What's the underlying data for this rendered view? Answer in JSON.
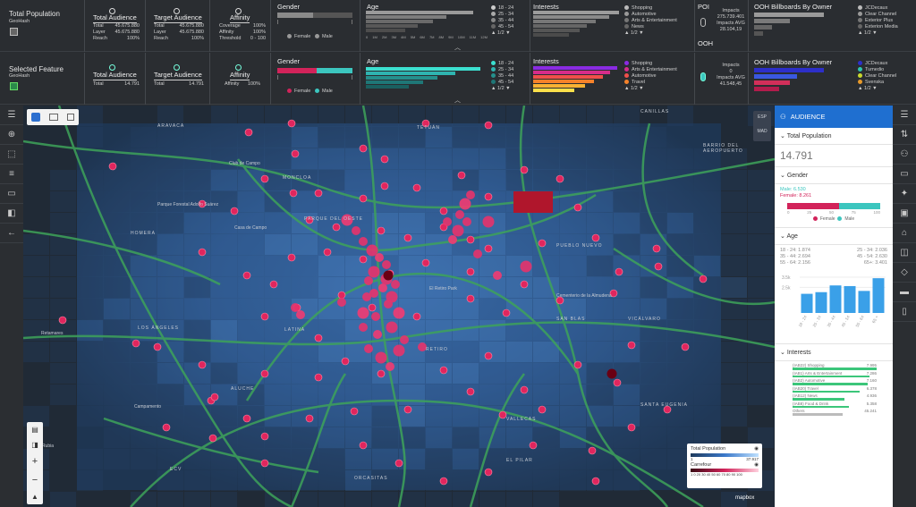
{
  "row1": {
    "title": "Total Population",
    "subtitle": "GeoHash",
    "total_audience": {
      "label": "Total Audience",
      "rows": [
        [
          "Total",
          "45.675.880"
        ],
        [
          "Layer",
          "45.675.880"
        ],
        [
          "Reach",
          "100%"
        ]
      ]
    },
    "target_audience": {
      "label": "Target Audience",
      "rows": [
        [
          "Total",
          "45.675.880"
        ],
        [
          "Layer",
          "45.675.880"
        ],
        [
          "Reach",
          "100%"
        ]
      ]
    },
    "affinity": {
      "label": "Affinity",
      "rows": [
        [
          "Coverage",
          "100%"
        ],
        [
          "Affinity",
          "100%"
        ],
        [
          "Threshold",
          "0 - 100"
        ]
      ]
    },
    "gender": {
      "label": "Gender",
      "female": "Female",
      "male": "Male"
    },
    "age": {
      "label": "Age",
      "legend": [
        "18 - 24",
        "25 - 34",
        "35 - 44",
        "45 - 54"
      ],
      "page": "1/2"
    },
    "interests": {
      "label": "Interests",
      "legend": [
        "Shopping",
        "Automotive",
        "Arts & Entertainment",
        "News"
      ],
      "page": "1/2"
    },
    "poi": {
      "label": "POI",
      "impacts_label": "Impacts",
      "impacts": "275.739.401",
      "avg_label": "Impacts AVG",
      "avg": "28.104,19"
    },
    "ooh": {
      "label": "OOH",
      "title": "OOH Billboards By Owner",
      "legend": [
        "JCDecaux",
        "Clear Channel",
        "Exterior Plus",
        "Exterion Media"
      ],
      "page": "1/2"
    }
  },
  "row2": {
    "title": "Selected Feature",
    "subtitle": "GeoHash",
    "total_audience": {
      "label": "Total Audience",
      "rows": [
        [
          "Total",
          "14.791"
        ]
      ]
    },
    "target_audience": {
      "label": "Target Audience",
      "rows": [
        [
          "Total",
          "14.791"
        ]
      ]
    },
    "affinity": {
      "label": "Affinity",
      "rows": [
        [
          "Affinity",
          "100%"
        ]
      ]
    },
    "gender": {
      "label": "Gender",
      "female": "Female",
      "male": "Male"
    },
    "age": {
      "label": "Age",
      "legend": [
        "18 - 24",
        "25 - 34",
        "35 - 44",
        "45 - 54"
      ],
      "page": "1/2"
    },
    "interests": {
      "label": "Interests",
      "legend": [
        "Shopping",
        "Arts & Entertainment",
        "Automotive",
        "Travel"
      ],
      "page": "1/2"
    },
    "poi": {
      "label": "POI",
      "impacts_label": "Impacts",
      "impacts": "0",
      "avg_label": "Impacts AVG",
      "avg": "41.548,45"
    },
    "ooh": {
      "label": "OOH",
      "title": "OOH Billboards By Owner",
      "legend": [
        "JCDecaux",
        "Tumedio",
        "Clear Channel",
        "Svenska"
      ],
      "page": "1/2"
    }
  },
  "axis_ticks": [
    "0",
    "1M",
    "2M",
    "3M",
    "4M",
    "5M",
    "6M",
    "7M",
    "8M",
    "9M",
    "10M",
    "11M",
    "12M"
  ],
  "map": {
    "labels": [
      "ARAVACA",
      "CANILLAS",
      "Club de Campo",
      "MONCLOA",
      "HOMERA",
      "Parque Forestal Adolfo Suárez",
      "PARQUE DEL OESTE",
      "Casa de Campo",
      "BARRIO DEL AEROPUERTO",
      "PUEBLO NUEVO",
      "LATINA",
      "LOS ÁNGELES",
      "ALUCHE",
      "Campamento",
      "VALLECAS",
      "SAN BLAS",
      "VICÁLVARO",
      "RETIRO",
      "El Retiro Park",
      "SANTA EUGENIA",
      "ORCASITAS",
      "Retamares",
      "EL PILAR",
      "TETUÁN",
      "ECV",
      "La Rubia",
      "Cementerio de la Almudena"
    ],
    "esp": "ESP",
    "mad": "MAD",
    "mapbox": "mapbox",
    "legend": {
      "title": "Total Population",
      "min": "1",
      "max": "37.917",
      "layer": "Carrefour",
      "scale": "1 0 20 30 40 50 60 70 80 90 100"
    }
  },
  "panel": {
    "title": "AUDIENCE",
    "total_label": "Total Population",
    "total": "14.791",
    "gender_label": "Gender",
    "male": "Male: 6.530",
    "female": "Female: 8.261",
    "gender_ticks": [
      "0",
      "25",
      "50",
      "75",
      "100"
    ],
    "female_leg": "Female",
    "male_leg": "Male",
    "age_label": "Age",
    "age_rows": [
      [
        "18 - 24: 1.874",
        "25 - 34: 2.036"
      ],
      [
        "35 - 44: 2.694",
        "45 - 54: 2.630"
      ],
      [
        "55 - 64: 2.156",
        "65+: 3.401"
      ]
    ],
    "age_ticks": [
      "3.5k",
      "2.5k"
    ],
    "age_cats": [
      "18 - 24",
      "25 - 34",
      "35 - 44",
      "45 - 54",
      "55 - 64",
      "65 +"
    ],
    "age_values": [
      1874,
      2036,
      2694,
      2630,
      2156,
      3401
    ],
    "interests_label": "Interests",
    "interests": [
      [
        "(IAB22) Shopping",
        "7.995"
      ],
      [
        "(IAB1) Arts & Entertainment",
        "7.286"
      ],
      [
        "(IAB2) Automotive",
        "7.160"
      ],
      [
        "(IAB20) Travel",
        "6.378"
      ],
      [
        "(IAB12) News",
        "4.936"
      ],
      [
        "(IAB8) Food & Drink",
        "5.358"
      ],
      [
        "Others",
        "45.241"
      ]
    ]
  },
  "colors": {
    "accent": "#1f6fd0",
    "female": "#d2235a",
    "male": "#3cc6bf",
    "bar": "#3aa0e8",
    "marker": "#e0265e"
  }
}
